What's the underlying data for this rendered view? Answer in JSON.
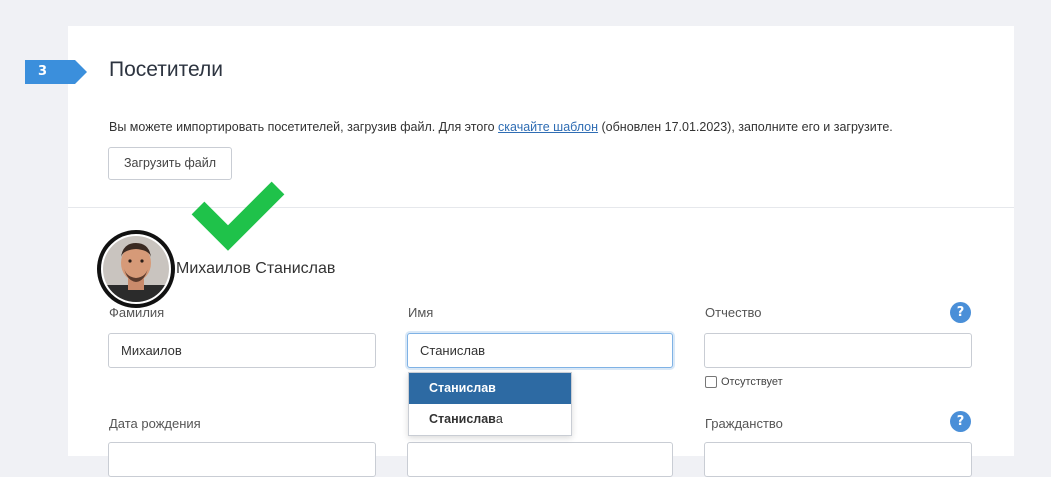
{
  "section": {
    "step_number": "3",
    "title": "Посетители",
    "accent_color": "#3b8fdc"
  },
  "import": {
    "text_before": "Вы можете импортировать посетителей, загрузив файл. Для этого ",
    "link": "скачайте шаблон",
    "text_after": " (обновлен 17.01.2023), заполните его и загрузите.",
    "upload_button": "Загрузить файл"
  },
  "person": {
    "name": "Михаилов Станислав",
    "verified_color": "#1fc24a"
  },
  "fields": {
    "last_name": {
      "label": "Фамилия",
      "value": "Михаилов"
    },
    "first_name": {
      "label": "Имя",
      "value": "Станислав"
    },
    "patronymic": {
      "label": "Отчество",
      "value": "",
      "absent_label": "Отсутствует",
      "help": "?"
    },
    "birth_date": {
      "label": "Дата рождения"
    },
    "citizenship": {
      "label": "Гражданство",
      "help": "?"
    }
  },
  "autocomplete": {
    "options": [
      {
        "match": "Станислав",
        "rest": ""
      },
      {
        "match": "Станислав",
        "rest": "а"
      }
    ]
  }
}
